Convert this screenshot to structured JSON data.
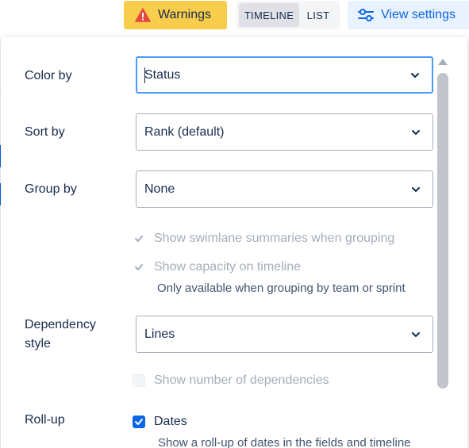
{
  "toolbar": {
    "warnings_label": "Warnings",
    "segments": [
      "TIMELINE",
      "LIST"
    ],
    "active_segment": "TIMELINE",
    "view_settings_label": "View settings",
    "icons": {
      "warnings": "warning-triangle-icon",
      "view_settings": "sliders-icon"
    },
    "colors": {
      "warnings_bg": "#f8cd4c",
      "view_settings_bg": "#e9f2ff",
      "accent": "#0c66e4"
    }
  },
  "settings": {
    "color_by": {
      "label": "Color by",
      "value": "Status",
      "focused": true
    },
    "sort_by": {
      "label": "Sort by",
      "value": "Rank (default)"
    },
    "group_by": {
      "label": "Group by",
      "value": "None"
    },
    "grouping_options": {
      "swimlane_summaries": {
        "label": "Show swimlane summaries when grouping",
        "checked": true,
        "disabled": true
      },
      "capacity": {
        "label": "Show capacity on timeline",
        "checked": true,
        "disabled": true
      },
      "capacity_helper": "Only available when grouping by team or sprint"
    },
    "dependency_style": {
      "label_line1": "Dependency",
      "label_line2": "style",
      "value": "Lines",
      "show_number": {
        "label": "Show number of dependencies",
        "checked": false,
        "disabled": true
      }
    },
    "roll_up": {
      "label": "Roll-up",
      "dates": {
        "label": "Dates",
        "checked": true
      },
      "helper": "Show a roll-up of dates in the fields and timeline"
    }
  }
}
